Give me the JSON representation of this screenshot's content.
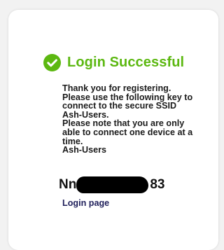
{
  "card": {
    "title": "Login Successful",
    "title_color": "#5cb811",
    "check_icon": "check-circle-icon",
    "message_lines": [
      "Thank you for registering.",
      "Please use the following key to",
      "connect to the secure SSID",
      "Ash-Users.",
      "Please note that you are only",
      "able to connect one device at a",
      "time.",
      "Ash-Users"
    ],
    "key_prefix": "Nn",
    "key_suffix": "83",
    "login_link_label": "Login page",
    "link_color": "#1e1e5a"
  }
}
